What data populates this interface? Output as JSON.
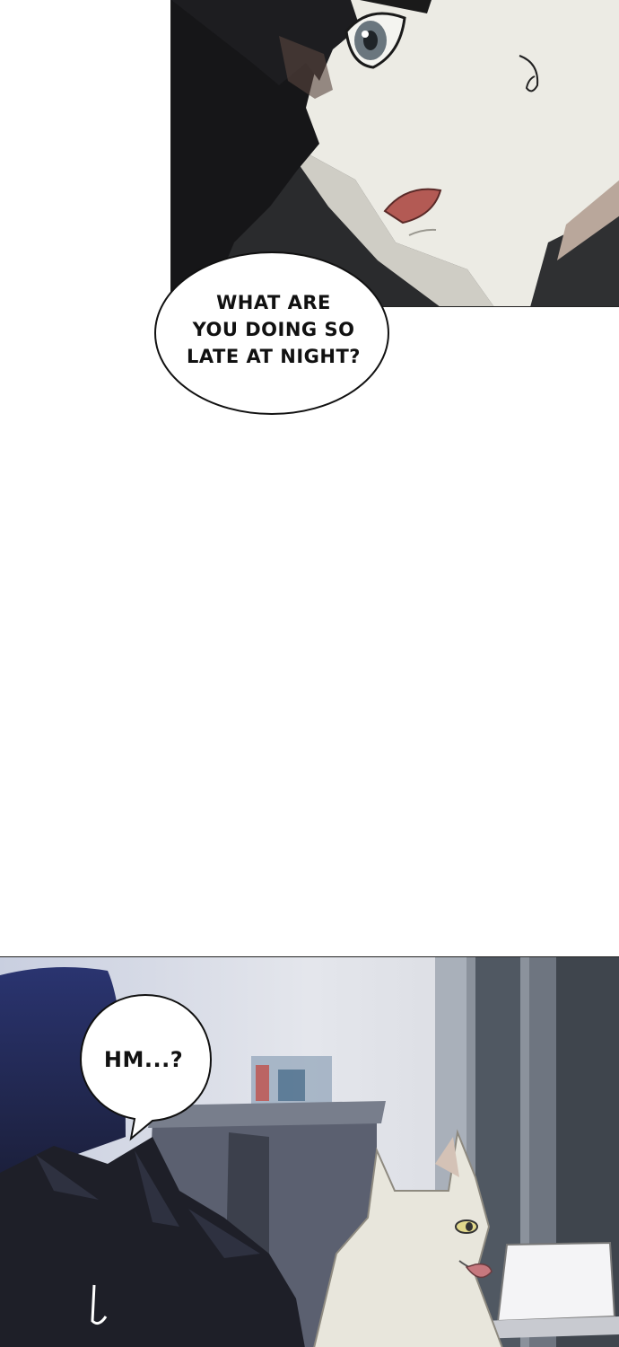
{
  "comic": {
    "bubble_top": {
      "line1": "WHAT ARE",
      "line2": "YOU DOING SO",
      "line3": "LATE AT NIGHT?"
    },
    "bubble_bottom": {
      "text": "HM...?"
    }
  },
  "colors": {
    "page_background": "#ffffff",
    "hair": "#1a1a1c",
    "skin": "#ecebe4",
    "wall": "#d6d9e3",
    "window_dark": "#3a4048",
    "dog": "#e8e6dc"
  }
}
